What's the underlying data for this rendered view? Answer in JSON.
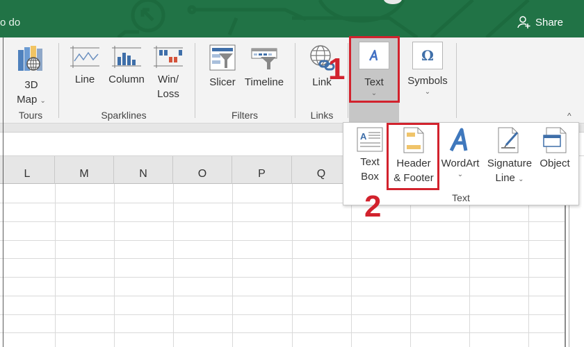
{
  "titlebar": {
    "tell_me_fragment": "o do",
    "share_label": "Share",
    "background_color": "#217346"
  },
  "ribbon": {
    "groups": [
      {
        "label": "Tours",
        "buttons": [
          {
            "line1": "3D",
            "line2": "Map",
            "has_dropdown": true
          }
        ]
      },
      {
        "label": "Sparklines",
        "buttons": [
          {
            "line1": "Line"
          },
          {
            "line1": "Column"
          },
          {
            "line1": "Win/",
            "line2": "Loss"
          }
        ]
      },
      {
        "label": "Filters",
        "buttons": [
          {
            "line1": "Slicer"
          },
          {
            "line1": "Timeline"
          }
        ]
      },
      {
        "label": "Links",
        "buttons": [
          {
            "line1": "Link"
          }
        ]
      },
      {
        "label": "",
        "buttons": [
          {
            "line1": "Text",
            "has_dropdown": true,
            "active": true
          },
          {
            "line1": "Symbols",
            "has_dropdown": true
          }
        ]
      }
    ]
  },
  "annotations": {
    "step1": "1",
    "step2": "2",
    "highlight_color": "#d2222d"
  },
  "text_dropdown": {
    "group_label": "Text",
    "items": [
      {
        "line1": "Text",
        "line2": "Box"
      },
      {
        "line1": "Header",
        "line2": "& Footer",
        "highlighted": true
      },
      {
        "line1": "WordArt",
        "has_dropdown": true
      },
      {
        "line1": "Signature",
        "line2": "Line",
        "has_dropdown": true
      },
      {
        "line1": "Object"
      }
    ]
  },
  "sheet": {
    "columns": [
      "L",
      "M",
      "N",
      "O",
      "P",
      "Q"
    ]
  }
}
